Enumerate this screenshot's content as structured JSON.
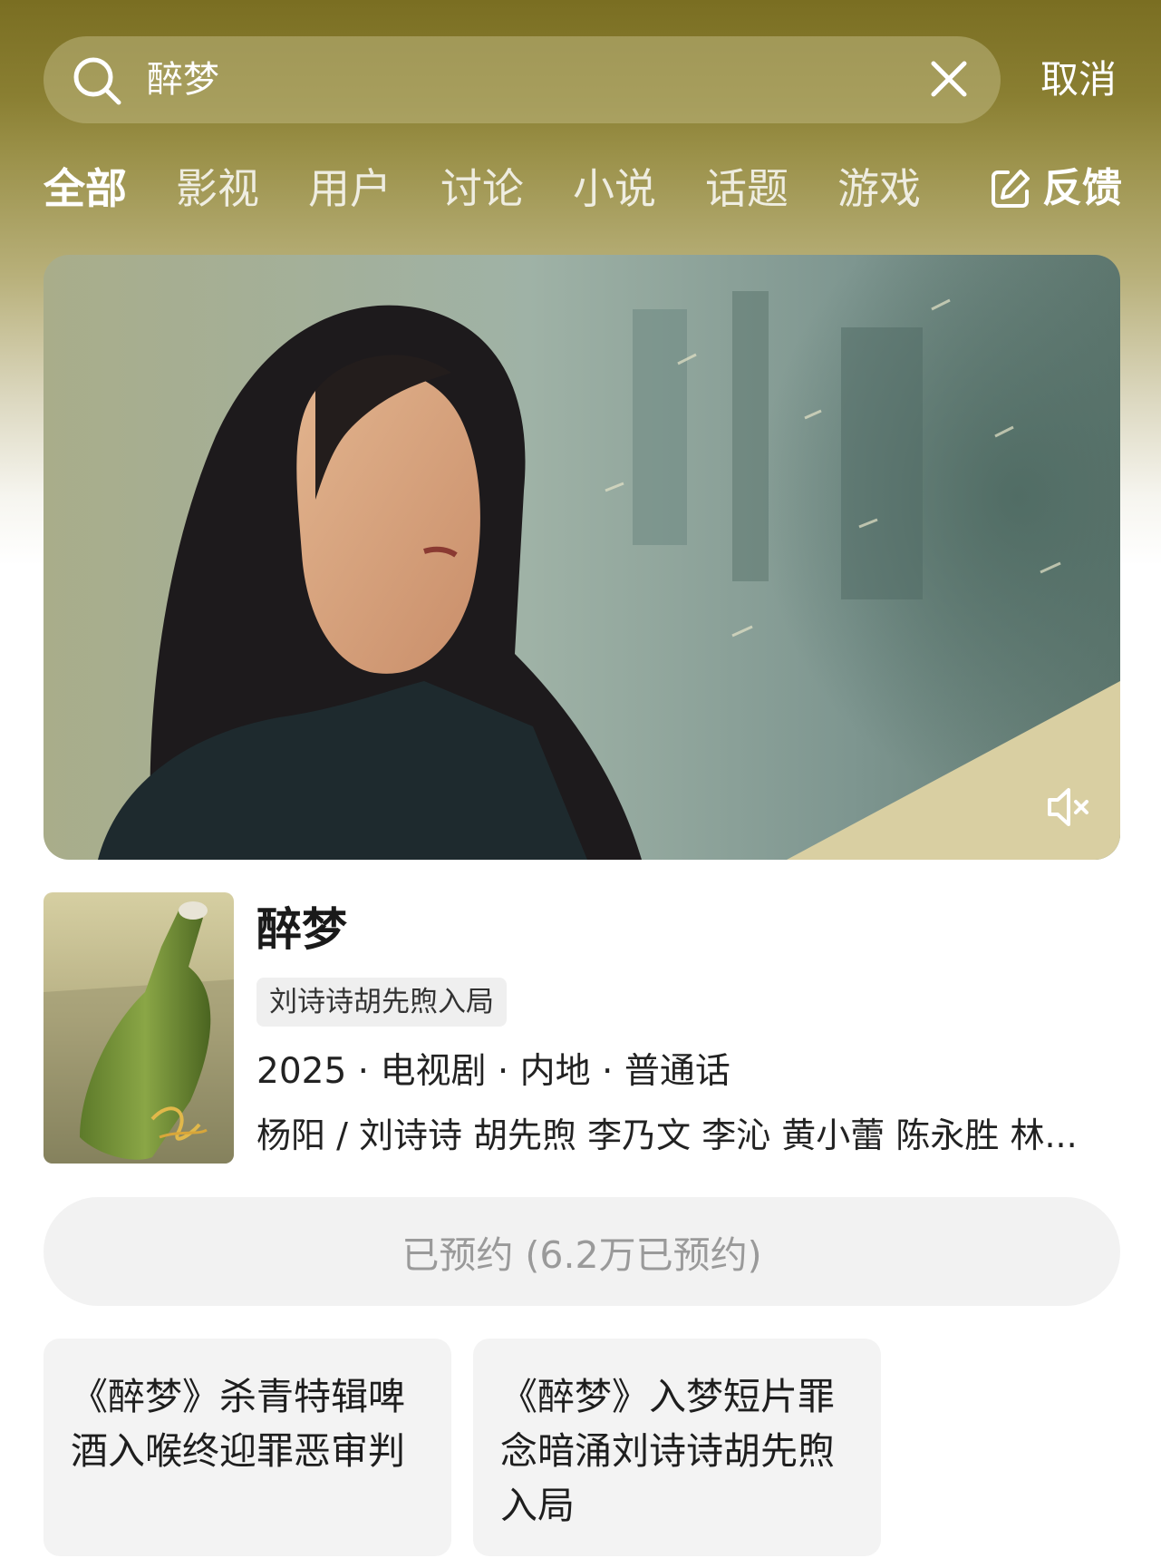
{
  "search": {
    "query": "醉梦",
    "cancel_label": "取消"
  },
  "tabs": [
    {
      "label": "全部",
      "active": true
    },
    {
      "label": "影视",
      "active": false
    },
    {
      "label": "用户",
      "active": false
    },
    {
      "label": "讨论",
      "active": false
    },
    {
      "label": "小说",
      "active": false
    },
    {
      "label": "话题",
      "active": false
    },
    {
      "label": "游戏",
      "active": false
    }
  ],
  "feedback": {
    "label": "反馈",
    "icon": "edit-icon"
  },
  "hero": {
    "icon": "mute-icon"
  },
  "show": {
    "title": "醉梦",
    "tag": "刘诗诗胡先煦入局",
    "meta": "2025 · 电视剧 · 内地 · 普通话",
    "cast": "杨阳 / 刘诗诗 胡先煦 李乃文 李沁 黄小蕾 陈永胜 林..."
  },
  "reserve": {
    "label": "已预约 (6.2万已预约)"
  },
  "cards": [
    {
      "text": "《醉梦》杀青特辑啤酒入喉终迎罪恶审判"
    },
    {
      "text": "《醉梦》入梦短片罪念暗涌刘诗诗胡先煦入局"
    }
  ],
  "colors": {
    "header_top": "#7a6e22",
    "reserve_bg": "#f2f2f2",
    "reserve_text": "#9a9a9a"
  }
}
